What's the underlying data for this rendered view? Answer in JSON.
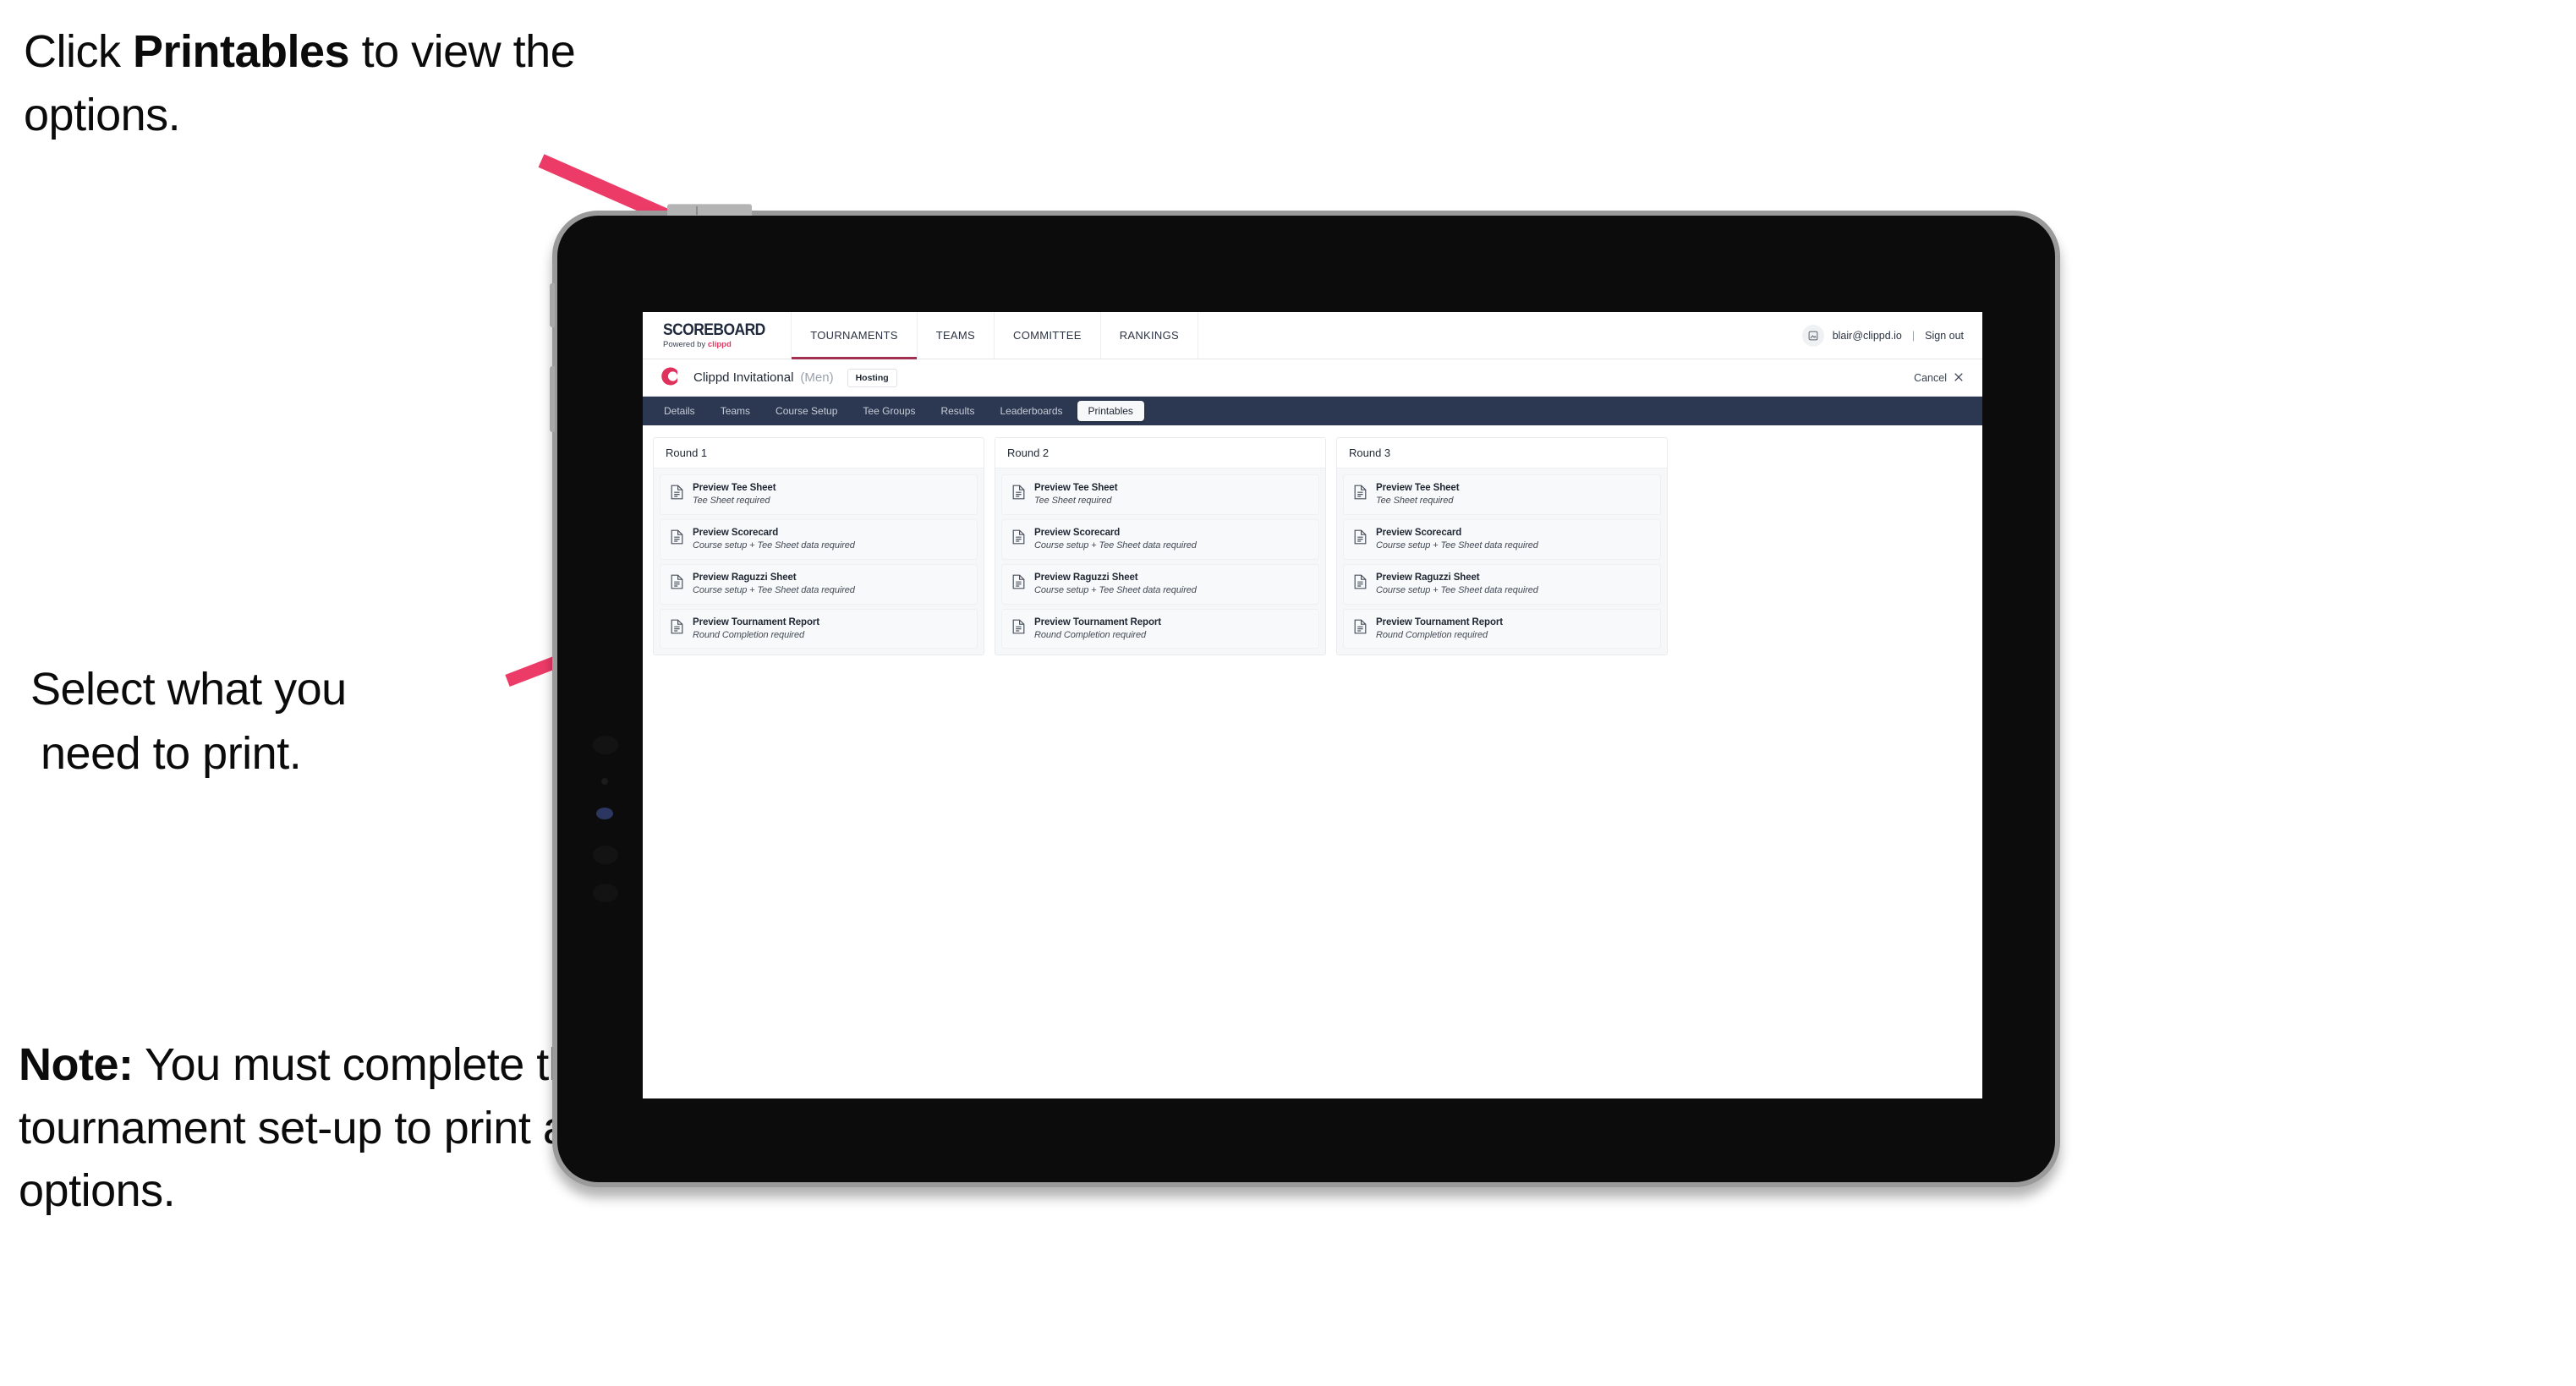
{
  "annotations": {
    "click_printables": {
      "prefix": "Click ",
      "bold": "Printables",
      "suffix": " to view the options."
    },
    "select_print": {
      "line1": "Select what you",
      "line2": "need to print."
    },
    "note": {
      "label": "Note:",
      "text": " You must complete the tournament set-up to print all the options."
    }
  },
  "colors": {
    "arrow_pink": "#ED3B68",
    "nav_dark": "#2C3851",
    "brand_red": "#E0315D",
    "active_underline": "#A23050"
  },
  "app": {
    "topnav": {
      "brand_title": "SCOREBOARD",
      "brand_sub_prefix": "Powered by ",
      "brand_sub_name": "clippd",
      "items": [
        {
          "label": "TOURNAMENTS",
          "active": true
        },
        {
          "label": "TEAMS",
          "active": false
        },
        {
          "label": "COMMITTEE",
          "active": false
        },
        {
          "label": "RANKINGS",
          "active": false
        }
      ],
      "user": {
        "avatar_icon": "user-avatar-icon",
        "email": "blair@clippd.io",
        "separator": "|",
        "sign_out": "Sign out"
      }
    },
    "tournament_bar": {
      "mark": "C",
      "name": "Clippd Invitational",
      "gender": "(Men)",
      "badge": "Hosting",
      "cancel_label": "Cancel",
      "cancel_icon": "close-x-icon"
    },
    "subtabs": [
      {
        "label": "Details",
        "active": false
      },
      {
        "label": "Teams",
        "active": false
      },
      {
        "label": "Course Setup",
        "active": false
      },
      {
        "label": "Tee Groups",
        "active": false
      },
      {
        "label": "Results",
        "active": false
      },
      {
        "label": "Leaderboards",
        "active": false
      },
      {
        "label": "Printables",
        "active": true
      }
    ],
    "rounds": [
      {
        "title": "Round 1",
        "items": [
          {
            "icon": "document-icon",
            "title": "Preview Tee Sheet",
            "sub": "Tee Sheet required"
          },
          {
            "icon": "document-icon",
            "title": "Preview Scorecard",
            "sub": "Course setup + Tee Sheet data required"
          },
          {
            "icon": "document-icon",
            "title": "Preview Raguzzi Sheet",
            "sub": "Course setup + Tee Sheet data required"
          },
          {
            "icon": "document-icon",
            "title": "Preview Tournament Report",
            "sub": "Round Completion required"
          }
        ]
      },
      {
        "title": "Round 2",
        "items": [
          {
            "icon": "document-icon",
            "title": "Preview Tee Sheet",
            "sub": "Tee Sheet required"
          },
          {
            "icon": "document-icon",
            "title": "Preview Scorecard",
            "sub": "Course setup + Tee Sheet data required"
          },
          {
            "icon": "document-icon",
            "title": "Preview Raguzzi Sheet",
            "sub": "Course setup + Tee Sheet data required"
          },
          {
            "icon": "document-icon",
            "title": "Preview Tournament Report",
            "sub": "Round Completion required"
          }
        ]
      },
      {
        "title": "Round 3",
        "items": [
          {
            "icon": "document-icon",
            "title": "Preview Tee Sheet",
            "sub": "Tee Sheet required"
          },
          {
            "icon": "document-icon",
            "title": "Preview Scorecard",
            "sub": "Course setup + Tee Sheet data required"
          },
          {
            "icon": "document-icon",
            "title": "Preview Raguzzi Sheet",
            "sub": "Course setup + Tee Sheet data required"
          },
          {
            "icon": "document-icon",
            "title": "Preview Tournament Report",
            "sub": "Round Completion required"
          }
        ]
      }
    ]
  }
}
